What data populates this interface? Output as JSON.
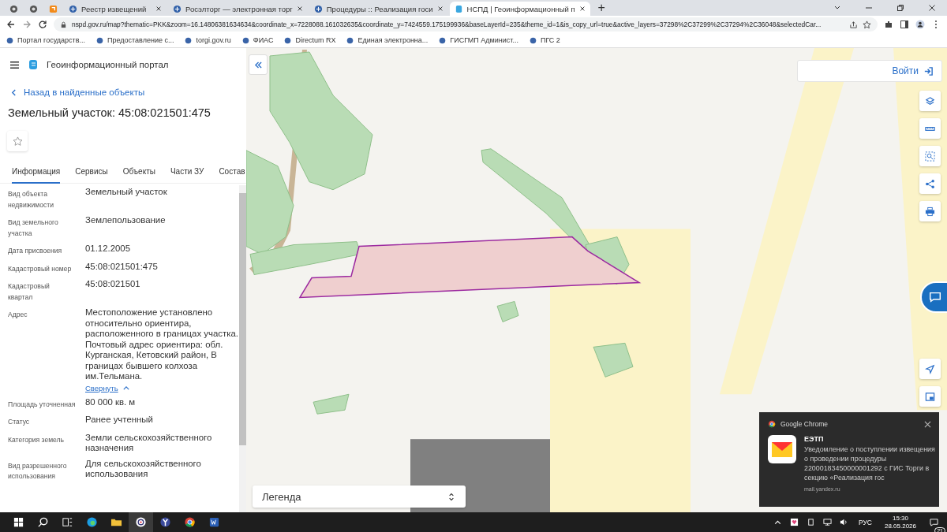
{
  "browser": {
    "tabs": [
      {
        "selected": false
      },
      {
        "selected": false
      },
      {
        "selected": false
      },
      {
        "title": "Реестр извещений",
        "selected": false
      },
      {
        "title": "Росэлторг — электронная торг",
        "selected": false
      },
      {
        "title": "Процедуры :: Реализация госи",
        "selected": false
      },
      {
        "title": "НСПД | Геоинформационный п",
        "selected": true
      }
    ],
    "new_tab": "+",
    "url": "nspd.gov.ru/map?thematic=PKK&zoom=16.14806381634634&coordinate_x=7228088.161032635&coordinate_y=7424559.175199936&baseLayerId=235&theme_id=1&is_copy_url=true&active_layers=37298%2C37299%2C37294%2C36048&selectedCar...",
    "bookmarks": [
      "Портал государств...",
      "Предоставление с...",
      "torgi.gov.ru",
      "ФИАС",
      "Directum RX",
      "Единая электронна...",
      "ГИСГМП Админист...",
      "ПГС 2"
    ]
  },
  "sidebar": {
    "portal_title": "Геоинформационный портал",
    "back_link": "Назад в найденные объекты",
    "heading": "Земельный участок: 45:08:021501:475",
    "tabs": [
      {
        "label": "Информация",
        "selected": true
      },
      {
        "label": "Сервисы",
        "selected": false
      },
      {
        "label": "Объекты",
        "selected": false
      },
      {
        "label": "Части ЗУ",
        "selected": false
      },
      {
        "label": "Состав",
        "selected": false
      }
    ],
    "properties": [
      {
        "label": "Вид объекта недвижимости",
        "value": "Земельный участок"
      },
      {
        "label": "Вид земельного участка",
        "value": "Землепользование"
      },
      {
        "label": "Дата присвоения",
        "value": "01.12.2005"
      },
      {
        "label": "Кадастровый номер",
        "value": "45:08:021501:475"
      },
      {
        "label": "Кадастровый квартал",
        "value": "45:08:021501"
      },
      {
        "label": "Адрес",
        "value": "Местоположение установлено относительно ориентира, расположенного в границах участка. Почтовый адрес ориентира: обл. Курганская, Кетовский район, В границах бывшего колхоза им.Тельмана.",
        "toggle_link": "Свернуть"
      },
      {
        "label": "Площадь уточненная",
        "value": "80 000 кв. м"
      },
      {
        "label": "Статус",
        "value": "Ранее учтенный"
      },
      {
        "label": "Категория земель",
        "value": "Земли сельскохозяйственного назначения"
      },
      {
        "label": "Вид разрешенного использования",
        "value": "Для сельскохозяйственного использования"
      }
    ]
  },
  "map": {
    "login_button": "Войти",
    "legend": "Легенда"
  },
  "notification": {
    "app": "Google Chrome",
    "title": "ЕЭТП",
    "body": "Уведомление о поступлении извещения о проведении процедуры 22000183450000001292 с ГИС Торги в секцию «Реализация гос",
    "source": "mail.yandex.ru"
  },
  "taskbar": {
    "language": "РУС",
    "time": "15:30",
    "date": "28.05.2026",
    "notification_count": "21"
  }
}
